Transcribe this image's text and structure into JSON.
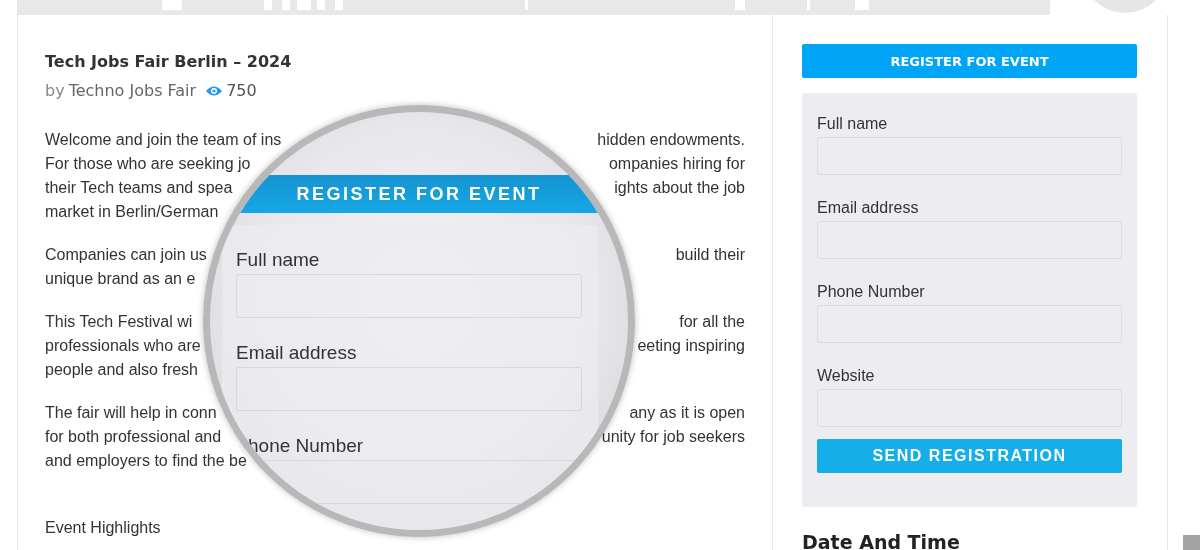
{
  "event": {
    "title": "Tech Jobs Fair Berlin – 2024",
    "byline_prefix": "by",
    "organizer": "Techno Jobs Fair",
    "views": "750"
  },
  "description": [
    {
      "lines": [
        {
          "left": "Welcome and join the team of ins",
          "right": "hidden endowments."
        },
        {
          "left": "For those who are seeking jo",
          "right": "ompanies hiring for"
        },
        {
          "left": "their Tech teams and spea",
          "right": "ights about the job"
        },
        {
          "left": "market in Berlin/German"
        }
      ]
    },
    {
      "lines": [
        {
          "left": "Companies can join us",
          "right": "build their"
        },
        {
          "left": "unique brand as an e"
        }
      ]
    },
    {
      "lines": [
        {
          "left": "This Tech Festival wi",
          "right": "for all the"
        },
        {
          "left": "professionals who are",
          "right": "eeting inspiring"
        },
        {
          "left": "people and also fresh"
        }
      ]
    },
    {
      "lines": [
        {
          "left": "The fair will help in conn",
          "right": "any as it is open"
        },
        {
          "left": "for both professional and",
          "right": "unity for job seekers"
        },
        {
          "left": "and employers to find the be"
        }
      ]
    }
  ],
  "section_heading": "Event Highlights",
  "magnifier": {
    "banner": "REGISTER FOR EVENT",
    "fields": [
      {
        "label": "Full name"
      },
      {
        "label": "Email address"
      },
      {
        "label": "hone Number",
        "kind": "cut"
      }
    ]
  },
  "sidebar": {
    "register_button": "REGISTER FOR EVENT",
    "fields": [
      {
        "label": "Full name"
      },
      {
        "label": "Email address"
      },
      {
        "label": "Phone Number"
      },
      {
        "label": "Website"
      }
    ],
    "submit_button": "SEND REGISTRATION",
    "section_heading": "Date And Time"
  }
}
